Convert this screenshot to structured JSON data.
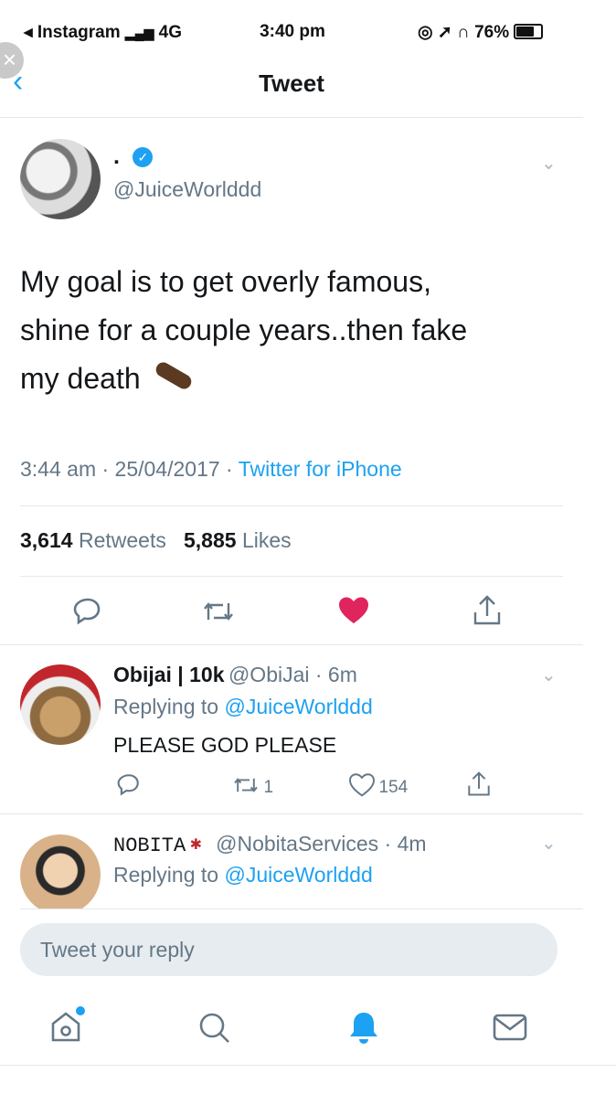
{
  "status_bar": {
    "back_app": "◂ Instagram",
    "signal": "4G",
    "time": "3:40 pm",
    "battery": "76%"
  },
  "nav": {
    "title": "Tweet",
    "back_icon": "chevron-left-icon"
  },
  "tweet": {
    "display_name": ".",
    "handle": "@JuiceWorlddd",
    "verified": true,
    "text_lines": [
      "My goal is to get overly famous,",
      "shine for a couple years..then fake",
      "my death"
    ],
    "time": "3:44 am · 25/04/2017 · ",
    "source": "Twitter for iPhone",
    "retweet_count": "3,614",
    "retweets_label": "Retweets",
    "like_count": "5,885",
    "likes_label": "Likes"
  },
  "replies": [
    {
      "name": "Obijai | 10k",
      "handle": "@ObiJai · 6m",
      "replying_label": "Replying to ",
      "replying_to": "@JuiceWorlddd",
      "body": "PLEASE GOD PLEASE",
      "retweets": "1",
      "likes": "154"
    },
    {
      "name": "NOBITA",
      "handle": "@NobitaServices · 4m",
      "replying_label": "Replying to ",
      "replying_to": "@JuiceWorlddd"
    }
  ],
  "compose": {
    "placeholder": "Tweet your reply"
  },
  "colors": {
    "accent": "#1da1f2",
    "like": "#e0245e",
    "muted": "#657786"
  }
}
